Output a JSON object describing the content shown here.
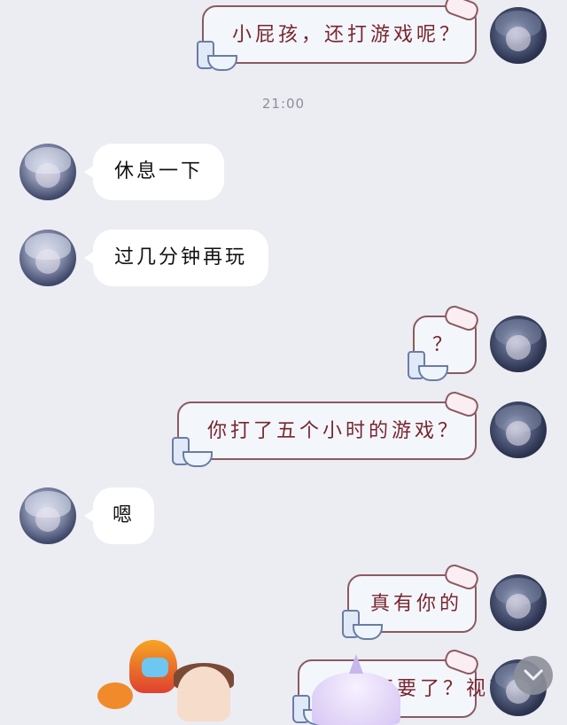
{
  "time_label": "21:00",
  "messages": [
    {
      "side": "right",
      "text": "小屁孩，还打游戏呢？"
    },
    {
      "side": "left",
      "text": "休息一下"
    },
    {
      "side": "left",
      "text": "过几分钟再玩"
    },
    {
      "side": "right",
      "text": "？"
    },
    {
      "side": "right",
      "text": "你打了五个小时的游戏？"
    },
    {
      "side": "left",
      "text": "嗯"
    },
    {
      "side": "right",
      "text": "真有你的"
    },
    {
      "side": "right",
      "text": "眼睛不要了？视不？"
    }
  ],
  "icons": {
    "scroll_down": "chevron-down-icon"
  },
  "colors": {
    "background": "#ececf3",
    "bubble_right_border": "#8b5a5f",
    "bubble_right_text": "#7a2530"
  }
}
